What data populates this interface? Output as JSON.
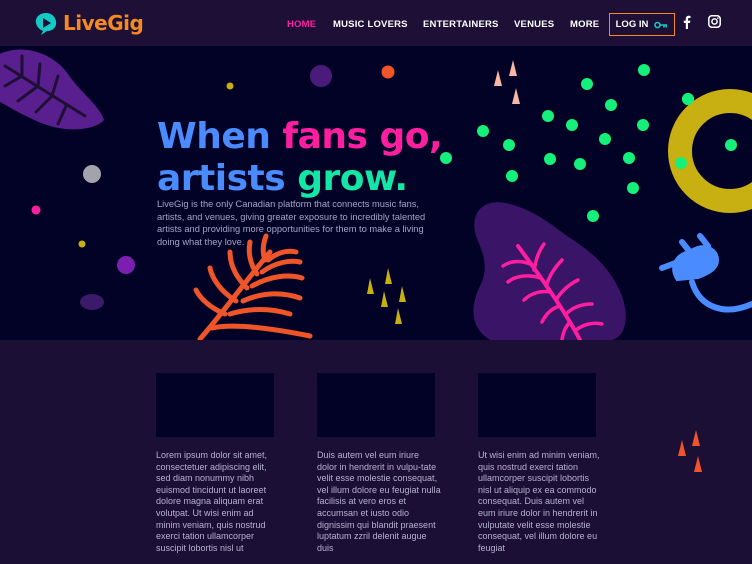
{
  "brand": {
    "name": "LiveGig"
  },
  "nav": {
    "items": [
      {
        "label": "HOME",
        "active": true
      },
      {
        "label": "MUSIC LOVERS",
        "active": false
      },
      {
        "label": "ENTERTAINERS",
        "active": false
      },
      {
        "label": "VENUES",
        "active": false
      },
      {
        "label": "MORE",
        "active": false
      }
    ],
    "login_label": "LOG IN",
    "social": [
      "facebook-icon",
      "instagram-icon"
    ]
  },
  "hero": {
    "headline": {
      "line1_a": "When ",
      "line1_b": "fans go,",
      "line2_a": "artists ",
      "line2_b": "grow."
    },
    "description": "LiveGig is the only Canadian platform that connects music fans, artists, and venues, giving greater exposure to incredibly talented artists and providing more opportunities for them to make a living doing what they love."
  },
  "features": {
    "cards": [
      {
        "text": "Lorem ipsum dolor sit amet, consectetuer adipiscing elit, sed diam nonummy nibh euismod tincidunt ut laoreet dolore magna aliquam erat volutpat. Ut wisi enim ad minim veniam, quis nostrud exerci tation ullamcorper suscipit lobortis nisl ut"
      },
      {
        "text": "Duis autem vel eum iriure dolor in hendrerit in vulpu-tate velit esse molestie consequat, vel illum dolore eu feugiat nulla facilisis at vero eros et accumsan et iusto odio dignissim qui blandit praesent luptatum zzril delenit augue duis"
      },
      {
        "text": "Ut wisi enim ad minim veniam, quis nostrud exerci tation ullamcorper suscipit lobortis nisl ut aliquip ex ea commodo consequat. Duis autem vel eum iriure dolor in hendrerit in vulputate velit esse molestie consequat, vel illum dolore eu feugiat"
      }
    ]
  },
  "colors": {
    "nav_bg": "#1d0f35",
    "hero_bg": "#020226",
    "accent_orange": "#f58a22",
    "accent_pink": "#ff1ea0",
    "accent_blue": "#4a8cff",
    "accent_green": "#14e6a6"
  }
}
